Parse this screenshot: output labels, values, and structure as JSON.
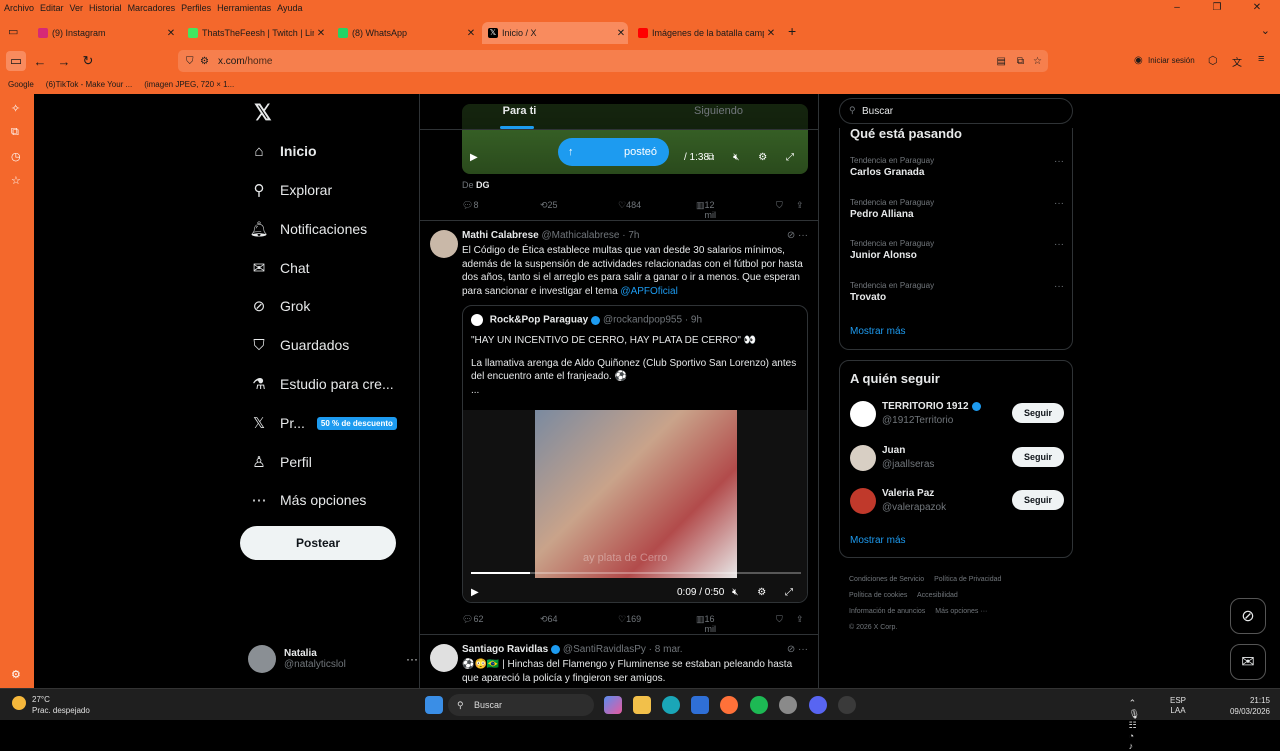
{
  "browser": {
    "menu": [
      "Archivo",
      "Editar",
      "Ver",
      "Historial",
      "Marcadores",
      "Perfiles",
      "Herramientas",
      "Ayuda"
    ],
    "tabs": [
      {
        "label": "(9) Instagram",
        "icon": "instagram-icon",
        "color": "#d62976"
      },
      {
        "label": "ThatsTheFeesh | Twitch | Linktre",
        "icon": "linktree-icon",
        "color": "#43e660"
      },
      {
        "label": "(8) WhatsApp",
        "icon": "whatsapp-icon",
        "color": "#25d366"
      },
      {
        "label": "Inicio / X",
        "icon": "x-icon",
        "color": "#000000"
      },
      {
        "label": "Imágenes de la batalla campal e",
        "icon": "youtube-icon",
        "color": "#ff0000"
      }
    ],
    "url_host": "x.com",
    "url_path": "/home",
    "signin": "Iniciar sesión",
    "bookmarks": [
      "Google",
      "(6)TikTok - Make Your ...",
      "(imagen JPEG, 720 × 1..."
    ],
    "accent": "#f4682c"
  },
  "nav": {
    "items": [
      {
        "label": "Inicio",
        "icon": "home-icon"
      },
      {
        "label": "Explorar",
        "icon": "search-icon"
      },
      {
        "label": "Notificaciones",
        "icon": "bell-icon"
      },
      {
        "label": "Chat",
        "icon": "mail-icon"
      },
      {
        "label": "Grok",
        "icon": "grok-icon"
      },
      {
        "label": "Guardados",
        "icon": "bookmark-icon"
      },
      {
        "label": "Estudio para cre...",
        "icon": "flask-icon"
      },
      {
        "label": "Pr...",
        "icon": "x-icon"
      },
      {
        "label": "Perfil",
        "icon": "person-icon"
      },
      {
        "label": "Más opciones",
        "icon": "more-icon"
      }
    ],
    "premium_badge": "50 % de descuento",
    "post_button": "Postear",
    "profile_name": "Natalia",
    "profile_handle": "@natalyticslol"
  },
  "timeline": {
    "tabs": [
      "Para ti",
      "Siguiendo"
    ],
    "top_post": {
      "posteo_pill": "posteó",
      "video_time": "/ 1:38",
      "from_prefix": "De",
      "from_name": "DG",
      "replies": "8",
      "reposts": "25",
      "likes": "484",
      "views": "12 mil"
    },
    "tweet1": {
      "name": "Mathi Calabrese",
      "handle": "@Mathicalabrese · 7h",
      "text": "El Código de Ética establece multas que van desde 30 salarios mínimos, además de la suspensión de actividades relacionadas con el fútbol por hasta dos años, tanto si el arreglo es para salir a ganar o ir a menos. Que esperan para sancionar e investigar el tema",
      "mention": "@APFOficial",
      "quote_name": "Rock&Pop Paraguay",
      "quote_handle": "@rockandpop955 · 9h",
      "quote_line1": "\"HAY UN INCENTIVO DE CERRO, HAY PLATA DE CERRO\" 👀",
      "quote_line2": "La llamativa arenga de Aldo Quiñonez (Club Sportivo San Lorenzo) antes del encuentro ante el franjeado. ⚽",
      "quote_more": "...",
      "video_time": "0:09 / 0:50",
      "video_progress": 0.18,
      "subtitle": "ay plata de Cerro",
      "replies": "62",
      "reposts": "64",
      "likes": "169",
      "views": "16 mil"
    },
    "tweet2": {
      "name": "Santiago Ravidlas",
      "handle": "@SantiRavidlasPy · 8 mar.",
      "text": "⚽😳🇧🇷 | Hinchas del Flamengo y Fluminense se estaban peleando hasta que apareció la policía y fingieron ser amigos."
    }
  },
  "right": {
    "search_placeholder": "Buscar",
    "trends_title": "Qué está pasando",
    "trends": [
      {
        "context": "Tendencia en Paraguay",
        "name": "Carlos Granada"
      },
      {
        "context": "Tendencia en Paraguay",
        "name": "Pedro Alliana"
      },
      {
        "context": "Tendencia en Paraguay",
        "name": "Junior Alonso"
      },
      {
        "context": "Tendencia en Paraguay",
        "name": "Trovato"
      }
    ],
    "show_more": "Mostrar más",
    "follow_title": "A quién seguir",
    "follow": [
      {
        "name": "TERRITORIO 1912",
        "handle": "@1912Territorio",
        "button": "Seguir",
        "color": "#ffffff"
      },
      {
        "name": "Juan",
        "handle": "@jaallseras",
        "button": "Seguir",
        "color": "#d8cfc4"
      },
      {
        "name": "Valeria Paz",
        "handle": "@valerapazok",
        "button": "Seguir",
        "color": "#c0392b"
      }
    ],
    "footer": [
      "Condiciones de Servicio",
      "Política de Privacidad",
      "Política de cookies",
      "Accesibilidad",
      "Información de anuncios",
      "Más opciones ···",
      "© 2026 X Corp."
    ]
  },
  "taskbar": {
    "temp": "27°C",
    "weather": "Prac. despejado",
    "search": "Buscar",
    "lang1": "ESP",
    "lang2": "LAA",
    "time": "21:15",
    "date": "09/03/2026"
  }
}
